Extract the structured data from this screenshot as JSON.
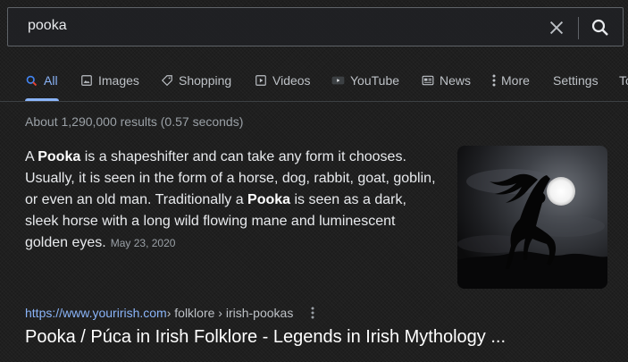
{
  "search": {
    "query": "pooka"
  },
  "tabs": [
    {
      "label": "All",
      "icon": "search-icon",
      "active": true
    },
    {
      "label": "Images",
      "icon": "image-icon"
    },
    {
      "label": "Shopping",
      "icon": "tag-icon"
    },
    {
      "label": "Videos",
      "icon": "play-icon"
    },
    {
      "label": "YouTube",
      "icon": "youtube-icon"
    },
    {
      "label": "News",
      "icon": "news-icon"
    },
    {
      "label": "More",
      "icon": "more-vert-icon"
    },
    {
      "label": "Settings"
    },
    {
      "label": "To"
    }
  ],
  "results_stats": "About 1,290,000 results (0.57 seconds)",
  "featured_snippet": {
    "parts": [
      {
        "text": "A ",
        "bold": false
      },
      {
        "text": "Pooka",
        "bold": true
      },
      {
        "text": " is a shapeshifter and can take any form it chooses. Usually, it is seen in the form of a horse, dog, rabbit, goat, goblin, or even an old man. Traditionally a ",
        "bold": false
      },
      {
        "text": "Pooka",
        "bold": true
      },
      {
        "text": " is seen as a dark, sleek horse with a long wild flowing mane and luminescent golden eyes.",
        "bold": false
      }
    ],
    "date": "May 23, 2020",
    "image": "horse-silhouette-moon-image"
  },
  "result": {
    "url": "https://www.yourirish.com",
    "breadcrumb": " › folklore › irish-pookas",
    "title": "Pooka / Púca in Irish Folklore - Legends in Irish Mythology ..."
  },
  "colors": {
    "accent": "#8ab4f8",
    "background": "#202124",
    "text": "#e8eaed",
    "muted": "#9aa0a6"
  }
}
